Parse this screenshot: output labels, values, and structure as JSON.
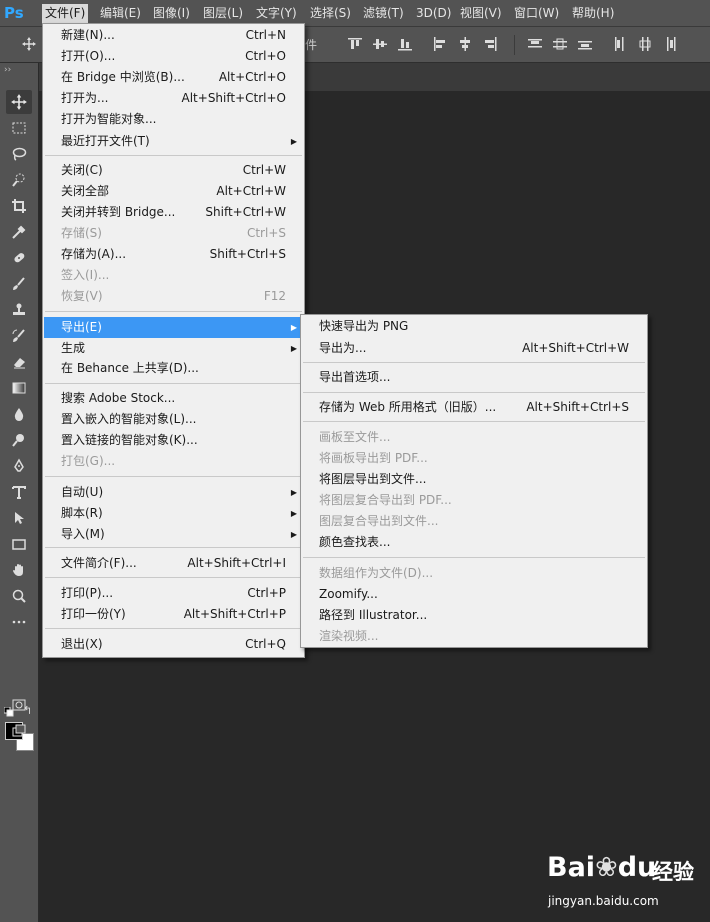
{
  "app": {
    "logo": "Ps",
    "accent_color": "#31a8ff",
    "highlight_color": "#3c97f4"
  },
  "menubar": {
    "items": [
      {
        "label": "文件(F)",
        "active": true
      },
      {
        "label": "编辑(E)"
      },
      {
        "label": "图像(I)"
      },
      {
        "label": "图层(L)"
      },
      {
        "label": "文字(Y)"
      },
      {
        "label": "选择(S)"
      },
      {
        "label": "滤镜(T)"
      },
      {
        "label": "3D(D)"
      },
      {
        "label": "视图(V)"
      },
      {
        "label": "窗口(W)"
      },
      {
        "label": "帮助(H)"
      }
    ]
  },
  "options_bar": {
    "partial_label": "件",
    "icons": [
      "move-icon",
      "align-top-edges-icon",
      "align-vertical-centers-icon",
      "align-bottom-edges-icon",
      "align-left-edges-icon",
      "align-horizontal-centers-icon",
      "align-right-edges-icon",
      "distribute-top-icon",
      "distribute-vertical-centers-icon",
      "distribute-bottom-icon",
      "distribute-left-icon",
      "distribute-horizontal-centers-icon",
      "distribute-right-icon"
    ]
  },
  "tools": [
    "move-tool-icon",
    "marquee-tool-icon",
    "lasso-tool-icon",
    "quick-select-tool-icon",
    "crop-tool-icon",
    "eyedropper-tool-icon",
    "healing-brush-tool-icon",
    "brush-tool-icon",
    "clone-stamp-tool-icon",
    "history-brush-tool-icon",
    "eraser-tool-icon",
    "gradient-tool-icon",
    "blur-tool-icon",
    "dodge-tool-icon",
    "pen-tool-icon",
    "type-tool-icon",
    "path-selection-tool-icon",
    "rectangle-tool-icon",
    "hand-tool-icon",
    "zoom-tool-icon",
    "edit-toolbar-icon"
  ],
  "file_menu": {
    "items": [
      {
        "label": "新建(N)...",
        "shortcut": "Ctrl+N"
      },
      {
        "label": "打开(O)...",
        "shortcut": "Ctrl+O"
      },
      {
        "label": "在 Bridge 中浏览(B)...",
        "shortcut": "Alt+Ctrl+O"
      },
      {
        "label": "打开为...",
        "shortcut": "Alt+Shift+Ctrl+O"
      },
      {
        "label": "打开为智能对象..."
      },
      {
        "label": "最近打开文件(T)",
        "submenu": true
      },
      {
        "label": "关闭(C)",
        "shortcut": "Ctrl+W"
      },
      {
        "label": "关闭全部",
        "shortcut": "Alt+Ctrl+W"
      },
      {
        "label": "关闭并转到 Bridge...",
        "shortcut": "Shift+Ctrl+W"
      },
      {
        "label": "存储(S)",
        "shortcut": "Ctrl+S",
        "disabled": true
      },
      {
        "label": "存储为(A)...",
        "shortcut": "Shift+Ctrl+S"
      },
      {
        "label": "签入(I)...",
        "disabled": true
      },
      {
        "label": "恢复(V)",
        "shortcut": "F12",
        "disabled": true
      },
      {
        "label": "导出(E)",
        "submenu": true,
        "highlighted": true
      },
      {
        "label": "生成",
        "submenu": true
      },
      {
        "label": "在 Behance 上共享(D)..."
      },
      {
        "label": "搜索 Adobe Stock..."
      },
      {
        "label": "置入嵌入的智能对象(L)..."
      },
      {
        "label": "置入链接的智能对象(K)..."
      },
      {
        "label": "打包(G)...",
        "disabled": true
      },
      {
        "label": "自动(U)",
        "submenu": true
      },
      {
        "label": "脚本(R)",
        "submenu": true
      },
      {
        "label": "导入(M)",
        "submenu": true
      },
      {
        "label": "文件简介(F)...",
        "shortcut": "Alt+Shift+Ctrl+I"
      },
      {
        "label": "打印(P)...",
        "shortcut": "Ctrl+P"
      },
      {
        "label": "打印一份(Y)",
        "shortcut": "Alt+Shift+Ctrl+P"
      },
      {
        "label": "退出(X)",
        "shortcut": "Ctrl+Q"
      }
    ]
  },
  "export_menu": {
    "items": [
      {
        "label": "快速导出为 PNG"
      },
      {
        "label": "导出为...",
        "shortcut": "Alt+Shift+Ctrl+W"
      },
      {
        "label": "导出首选项..."
      },
      {
        "label": "存储为 Web 所用格式（旧版）...",
        "shortcut": "Alt+Shift+Ctrl+S"
      },
      {
        "label": "画板至文件...",
        "disabled": true
      },
      {
        "label": "将画板导出到 PDF...",
        "disabled": true
      },
      {
        "label": "将图层导出到文件..."
      },
      {
        "label": "将图层复合导出到 PDF...",
        "disabled": true
      },
      {
        "label": "图层复合导出到文件...",
        "disabled": true
      },
      {
        "label": "颜色查找表..."
      },
      {
        "label": "数据组作为文件(D)...",
        "disabled": true
      },
      {
        "label": "Zoomify..."
      },
      {
        "label": "路径到 Illustrator..."
      },
      {
        "label": "渲染视频...",
        "disabled": true
      }
    ]
  },
  "watermark": {
    "brand": "Bai",
    "brand_suffix": "du",
    "cn": "经验",
    "url": "jingyan.baidu.com"
  }
}
